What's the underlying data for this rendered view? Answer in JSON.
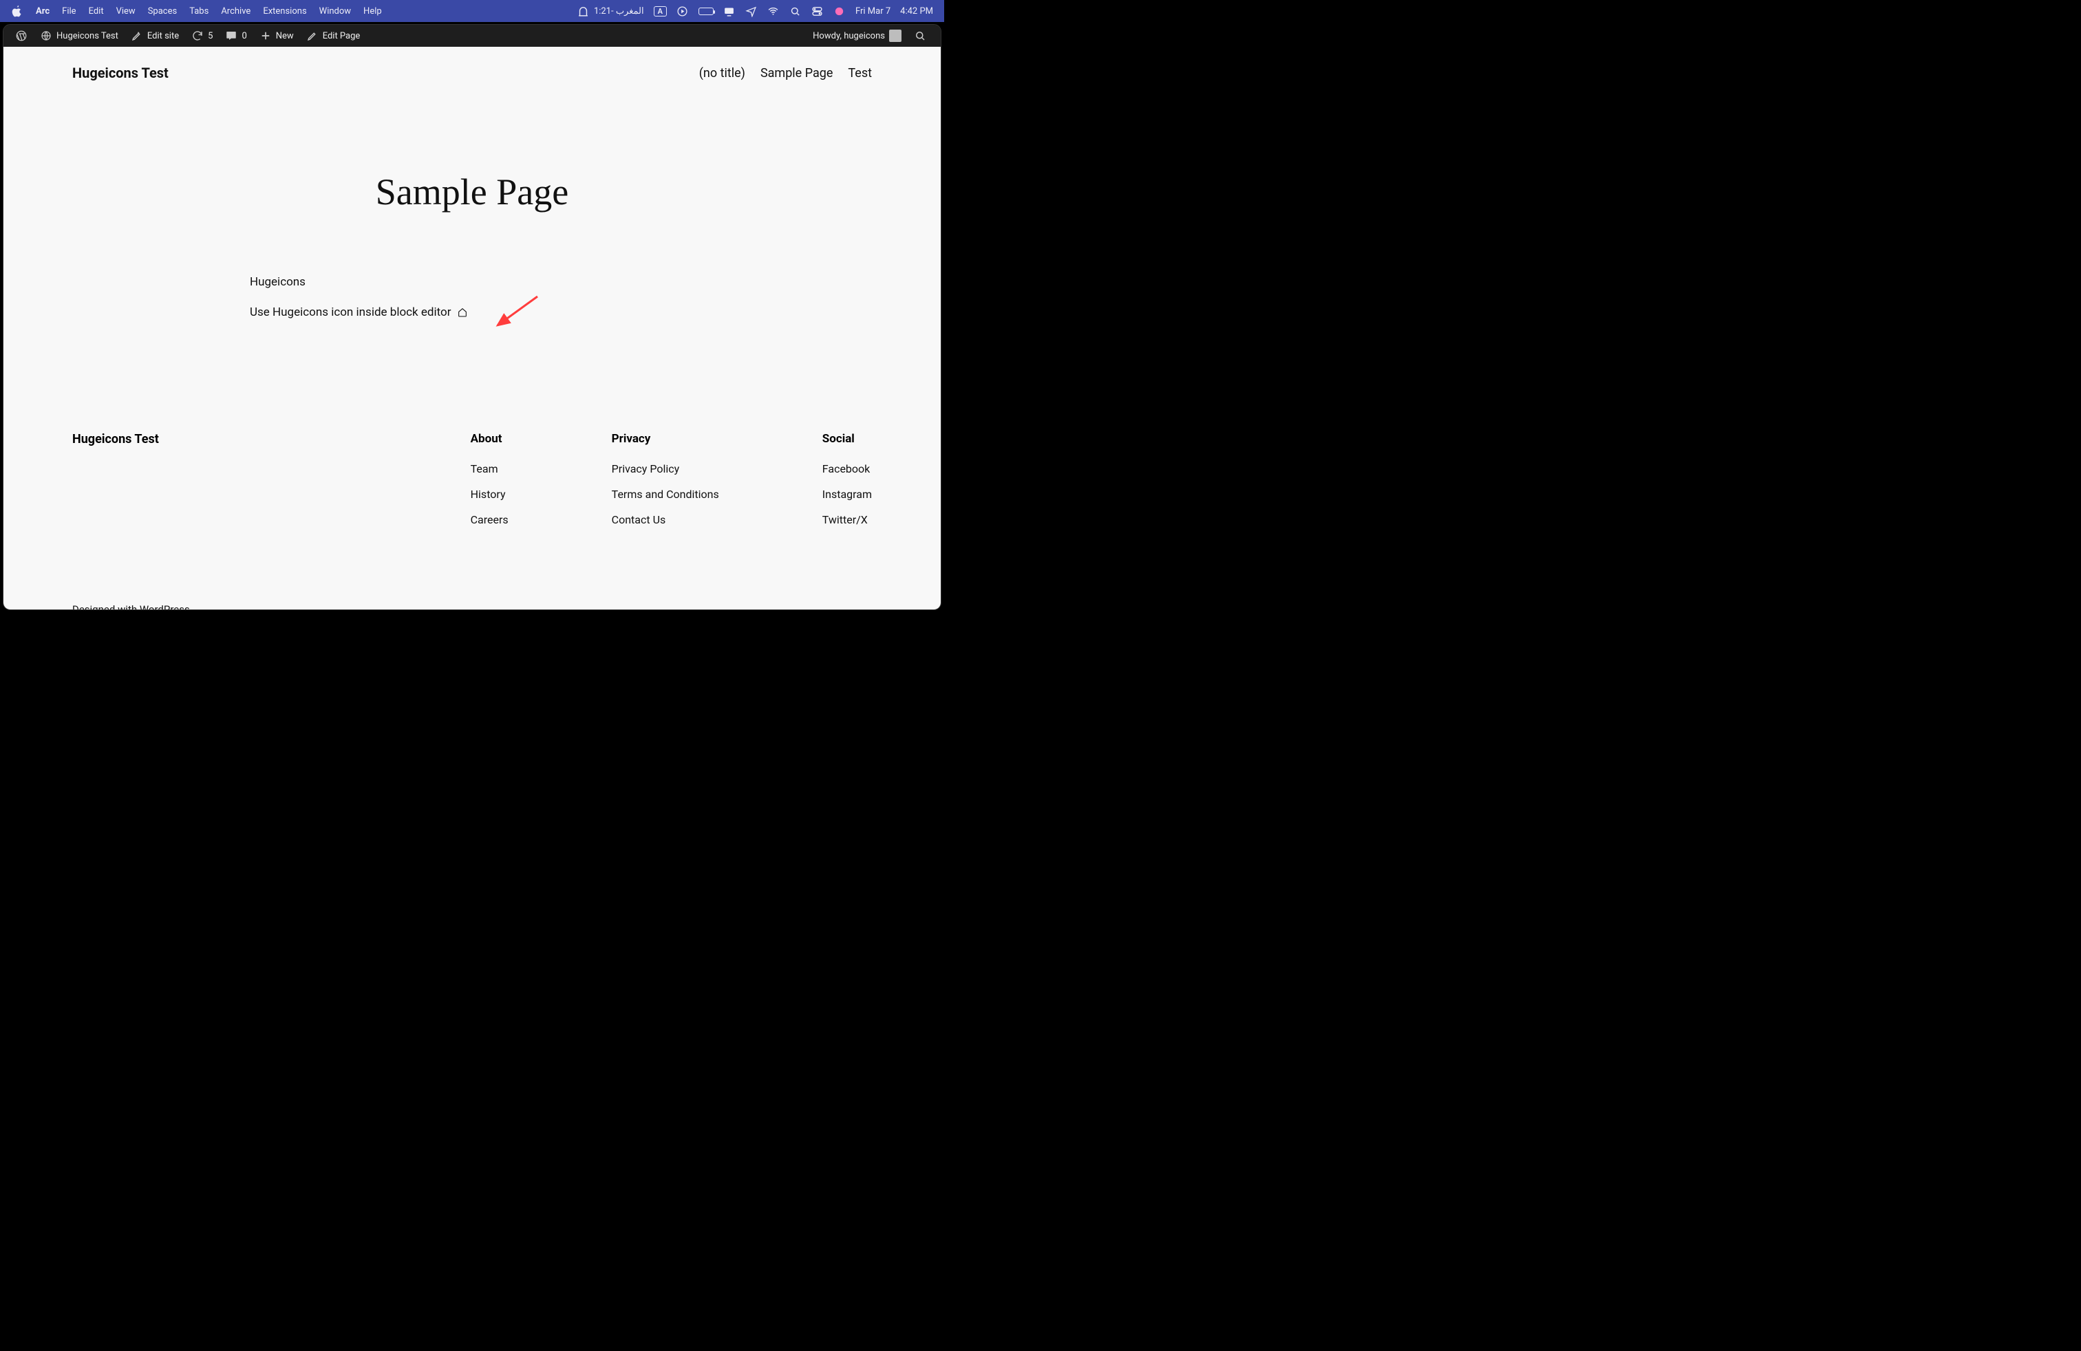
{
  "macos": {
    "app": "Arc",
    "menus": [
      "File",
      "Edit",
      "View",
      "Spaces",
      "Tabs",
      "Archive",
      "Extensions",
      "Window",
      "Help"
    ],
    "prayer": "1:21- المغرب",
    "lang": "A",
    "date": "Fri Mar 7",
    "time": "4:42 PM"
  },
  "wpadmin": {
    "site_name": "Hugeicons Test",
    "edit_site": "Edit site",
    "updates_count": "5",
    "comments_count": "0",
    "new_label": "New",
    "edit_page": "Edit Page",
    "howdy": "Howdy, hugeicons"
  },
  "site": {
    "title": "Hugeicons Test",
    "nav": [
      "(no title)",
      "Sample Page",
      "Test"
    ]
  },
  "page": {
    "heading": "Sample Page",
    "paragraph1": "Hugeicons",
    "paragraph2": "Use Hugeicons icon inside block editor "
  },
  "footer": {
    "brand": "Hugeicons Test",
    "columns": [
      {
        "heading": "About",
        "links": [
          "Team",
          "History",
          "Careers"
        ]
      },
      {
        "heading": "Privacy",
        "links": [
          "Privacy Policy",
          "Terms and Conditions",
          "Contact Us"
        ]
      },
      {
        "heading": "Social",
        "links": [
          "Facebook",
          "Instagram",
          "Twitter/X"
        ]
      }
    ],
    "colophon_prefix": "Designed with ",
    "colophon_link": "WordPress"
  }
}
